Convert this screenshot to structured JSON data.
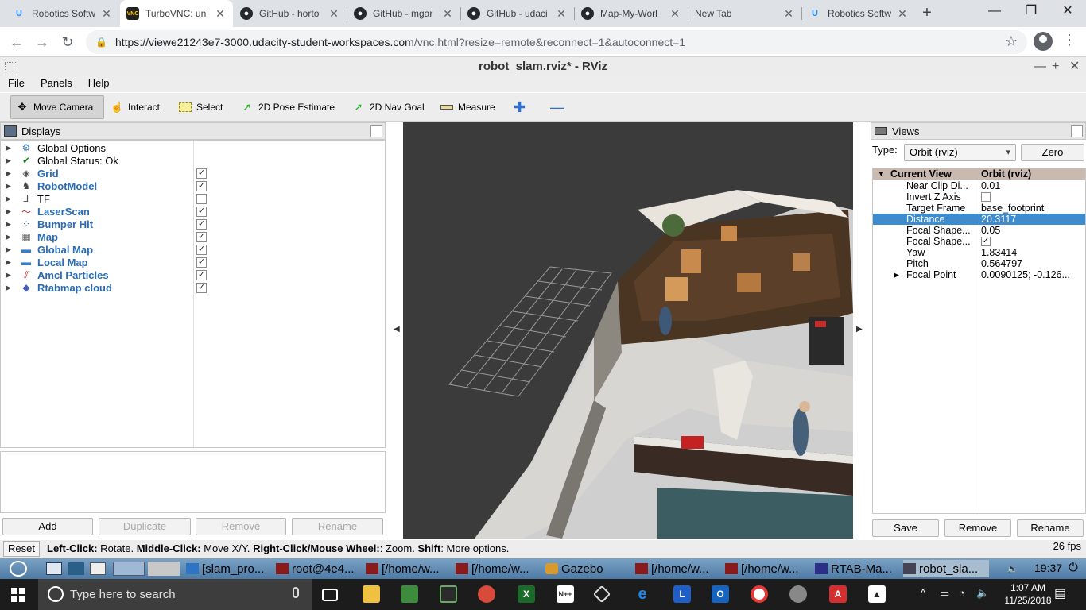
{
  "browser": {
    "tabs": [
      {
        "title": "Robotics Softw",
        "icon": "udacity-icon",
        "color": "#1e90ff"
      },
      {
        "title": "TurboVNC: un",
        "icon": "vnc-icon",
        "color": "#222222",
        "active": true
      },
      {
        "title": "GitHub - horto",
        "icon": "github-icon",
        "color": "#24292e"
      },
      {
        "title": "GitHub - mgar",
        "icon": "github-icon",
        "color": "#24292e"
      },
      {
        "title": "GitHub - udaci",
        "icon": "github-icon",
        "color": "#24292e"
      },
      {
        "title": "Map-My-Worl",
        "icon": "github-icon",
        "color": "#24292e"
      },
      {
        "title": "New Tab",
        "icon": "",
        "color": ""
      },
      {
        "title": "Robotics Softw",
        "icon": "udacity-icon",
        "color": "#1e90ff"
      }
    ],
    "url_main": "https://viewe21243e7-3000.udacity-student-workspaces.com",
    "url_path": "/vnc.html?resize=remote&reconnect=1&autoconnect=1"
  },
  "rviz": {
    "window_title": "robot_slam.rviz* - RViz",
    "menu": [
      "File",
      "Panels",
      "Help"
    ],
    "tools": [
      {
        "label": "Move Camera",
        "icon": "move-camera-icon",
        "active": true
      },
      {
        "label": "Interact",
        "icon": "hand-icon"
      },
      {
        "label": "Select",
        "icon": "select-icon"
      },
      {
        "label": "2D Pose Estimate",
        "icon": "green-arrow-icon"
      },
      {
        "label": "2D Nav Goal",
        "icon": "green-arrow-icon"
      },
      {
        "label": "Measure",
        "icon": "ruler-icon"
      }
    ],
    "displays": {
      "title": "Displays",
      "items": [
        {
          "label": "Global Options",
          "icon": "gear-icon",
          "bold": false,
          "checkbox": null
        },
        {
          "label": "Global Status: Ok",
          "icon": "check-icon",
          "bold": false,
          "checkbox": null
        },
        {
          "label": "Grid",
          "icon": "grid-icon",
          "bold": true,
          "checkbox": true
        },
        {
          "label": "RobotModel",
          "icon": "robot-icon",
          "bold": true,
          "checkbox": true
        },
        {
          "label": "TF",
          "icon": "tf-icon",
          "bold": false,
          "checkbox": false
        },
        {
          "label": "LaserScan",
          "icon": "laser-icon",
          "bold": true,
          "checkbox": true
        },
        {
          "label": "Bumper Hit",
          "icon": "points-icon",
          "bold": true,
          "checkbox": true
        },
        {
          "label": "Map",
          "icon": "map-icon",
          "bold": true,
          "checkbox": true
        },
        {
          "label": "Global Map",
          "icon": "folder-icon",
          "bold": true,
          "checkbox": true
        },
        {
          "label": "Local Map",
          "icon": "folder-icon",
          "bold": true,
          "checkbox": true
        },
        {
          "label": "Amcl Particles",
          "icon": "particles-icon",
          "bold": true,
          "checkbox": true
        },
        {
          "label": "Rtabmap cloud",
          "icon": "cloud-icon",
          "bold": true,
          "checkbox": true
        }
      ],
      "buttons": {
        "add": "Add",
        "duplicate": "Duplicate",
        "remove": "Remove",
        "rename": "Rename"
      }
    },
    "views": {
      "title": "Views",
      "type_label": "Type:",
      "type_value": "Orbit (rviz)",
      "zero": "Zero",
      "header_key": "Current View",
      "header_value": "Orbit (rviz)",
      "props": [
        {
          "key": "Near Clip Di...",
          "value": "0.01"
        },
        {
          "key": "Invert Z Axis",
          "value": "",
          "checkbox": false
        },
        {
          "key": "Target Frame",
          "value": "base_footprint"
        },
        {
          "key": "Distance",
          "value": "20.3117",
          "selected": true
        },
        {
          "key": "Focal Shape...",
          "value": "0.05"
        },
        {
          "key": "Focal Shape...",
          "value": "",
          "checkbox": true
        },
        {
          "key": "Yaw",
          "value": "1.83414"
        },
        {
          "key": "Pitch",
          "value": "0.564797"
        },
        {
          "key": "Focal Point",
          "value": "0.0090125; -0.126..."
        }
      ],
      "buttons": {
        "save": "Save",
        "remove": "Remove",
        "rename": "Rename"
      }
    },
    "status": {
      "reset": "Reset",
      "hint_parts": [
        {
          "b": "Left-Click:",
          "t": " Rotate. "
        },
        {
          "b": "Middle-Click:",
          "t": " Move X/Y. "
        },
        {
          "b": "Right-Click/Mouse Wheel:",
          "t": ": Zoom. "
        },
        {
          "b": "Shift",
          "t": ": More options."
        }
      ],
      "fps": "26 fps"
    }
  },
  "vnc_taskbar": {
    "items": [
      "[slam_pro...",
      "root@4e4...",
      "[/home/w...",
      "[/home/w...",
      "Gazebo",
      "[/home/w...",
      "[/home/w...",
      "RTAB-Ma...",
      "robot_sla..."
    ],
    "clock": "19:37"
  },
  "windows": {
    "search_placeholder": "Type here to search",
    "time": "1:07 AM",
    "date": "11/25/2018"
  }
}
